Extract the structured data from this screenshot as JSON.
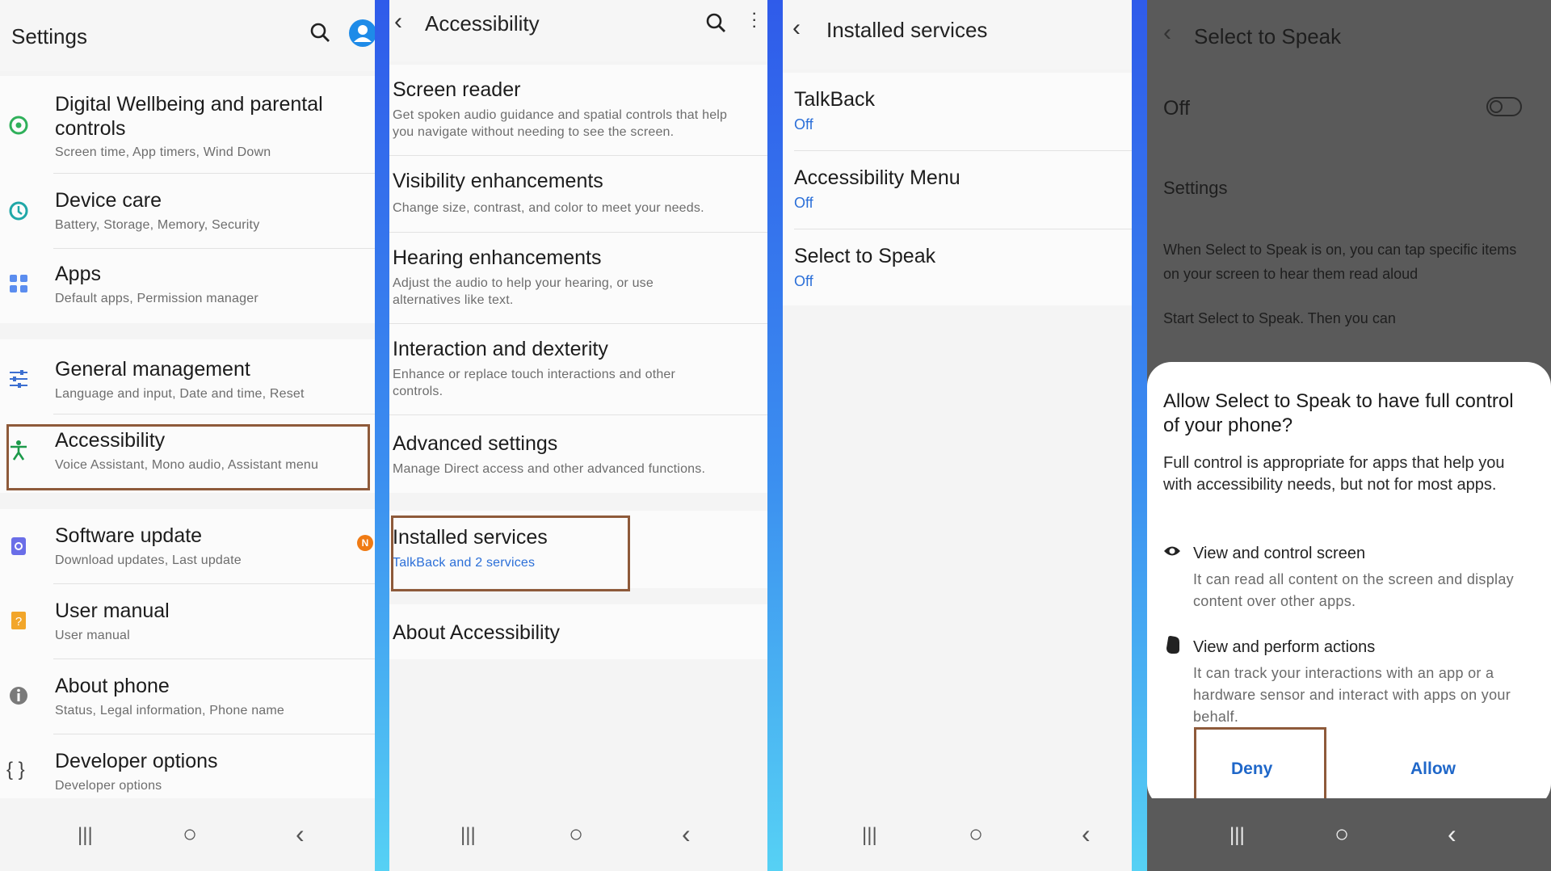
{
  "settings": {
    "title": "Settings",
    "items": [
      {
        "title": "Digital Wellbeing and parental controls",
        "subtitle": "Screen time, App timers, Wind Down"
      },
      {
        "title": "Device care",
        "subtitle": "Battery, Storage, Memory, Security"
      },
      {
        "title": "Apps",
        "subtitle": "Default apps, Permission manager"
      },
      {
        "title": "General management",
        "subtitle": "Language and input, Date and time, Reset"
      },
      {
        "title": "Accessibility",
        "subtitle": "Voice Assistant, Mono audio, Assistant menu"
      },
      {
        "title": "Software update",
        "subtitle": "Download updates, Last update",
        "badge": "N"
      },
      {
        "title": "User manual",
        "subtitle": "User manual"
      },
      {
        "title": "About phone",
        "subtitle": "Status, Legal information, Phone name"
      },
      {
        "title": "Developer options",
        "subtitle": "Developer options"
      }
    ]
  },
  "accessibility": {
    "title": "Accessibility",
    "items": [
      {
        "title": "Screen reader",
        "subtitle": "Get spoken audio guidance and spatial controls that help you navigate without needing to see the screen."
      },
      {
        "title": "Visibility enhancements",
        "subtitle": "Change size, contrast, and color to meet your needs."
      },
      {
        "title": "Hearing enhancements",
        "subtitle": "Adjust the audio to help your hearing, or use alternatives like text."
      },
      {
        "title": "Interaction and dexterity",
        "subtitle": "Enhance or replace touch interactions and other controls."
      },
      {
        "title": "Advanced settings",
        "subtitle": "Manage Direct access and other advanced functions."
      },
      {
        "title": "Installed services",
        "subtitle": "TalkBack and 2 services"
      },
      {
        "title": "About Accessibility"
      }
    ]
  },
  "installed": {
    "title": "Installed services",
    "items": [
      {
        "title": "TalkBack",
        "status": "Off"
      },
      {
        "title": "Accessibility Menu",
        "status": "Off"
      },
      {
        "title": "Select to Speak",
        "status": "Off"
      }
    ]
  },
  "sts": {
    "title": "Select to Speak",
    "toggle_label": "Off",
    "settings_label": "Settings",
    "desc": "When Select to Speak is on, you can tap specific items on your screen to hear them read aloud",
    "start_text": "Start Select to Speak. Then you can",
    "dialog": {
      "heading": "Allow Select to Speak to have full control of your phone?",
      "body": "Full control is appropriate for apps that help you with accessibility needs, but not for most apps.",
      "perm1_title": "View and control screen",
      "perm1_desc": "It can read all content on the screen and display content over other apps.",
      "perm2_title": "View and perform actions",
      "perm2_desc": "It can track your interactions with an app or a hardware sensor and interact with apps on your behalf.",
      "deny": "Deny",
      "allow": "Allow"
    }
  },
  "nav": {
    "recents": "|||",
    "home": "○",
    "back": "‹"
  },
  "colors": {
    "accent_blue": "#2b6fd8",
    "highlight": "#8e5a3a"
  }
}
